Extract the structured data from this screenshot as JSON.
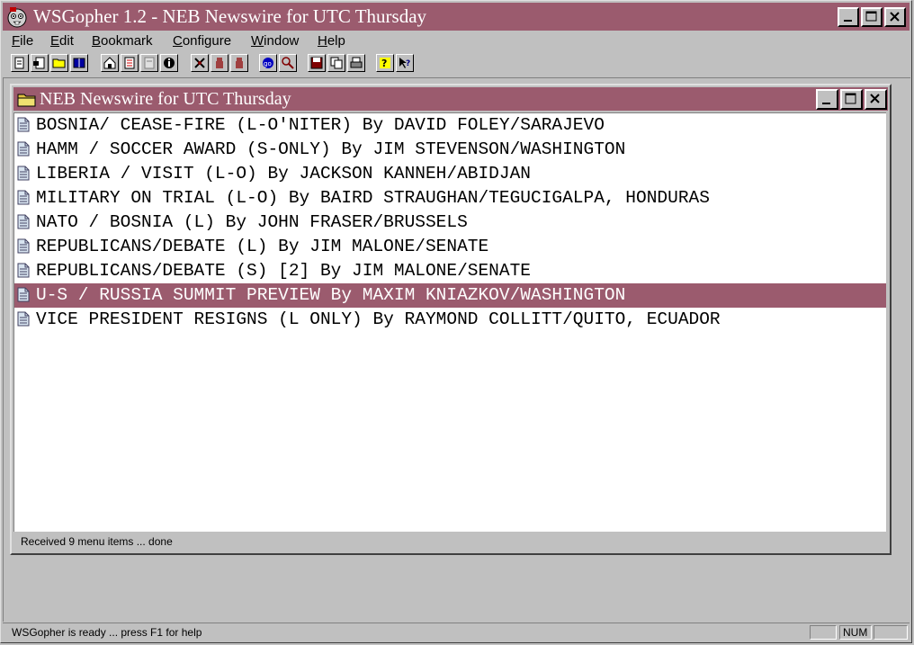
{
  "app": {
    "title": "WSGopher 1.2 - NEB Newswire for UTC Thursday",
    "title_color": "#9b5b6e"
  },
  "menu": [
    {
      "label": "File",
      "accel": "F",
      "rest": "ile"
    },
    {
      "label": "Edit",
      "accel": "E",
      "rest": "dit"
    },
    {
      "label": "Bookmark",
      "accel": "B",
      "rest": "ookmark"
    },
    {
      "label": "Configure",
      "accel": "C",
      "rest": "onfigure"
    },
    {
      "label": "Window",
      "accel": "W",
      "rest": "indow"
    },
    {
      "label": "Help",
      "accel": "H",
      "rest": "elp"
    }
  ],
  "toolbar": {
    "icons": [
      "new-doc-icon",
      "save-doc-icon",
      "open-folder-icon",
      "book-icon",
      "home-icon",
      "bookmark-list-icon",
      "bookmark-edit-icon",
      "info-icon",
      "fetch-icon",
      "stop-hand-icon",
      "cancel-hand-icon",
      "go-icon",
      "search-icon",
      "save-disk-icon",
      "copy-icon",
      "print-icon",
      "help-icon",
      "context-help-icon"
    ]
  },
  "child_window": {
    "title": "NEB Newswire for UTC Thursday",
    "items": [
      {
        "text": "BOSNIA/ CEASE-FIRE (L-O'NITER) By DAVID FOLEY/SARAJEVO",
        "selected": false
      },
      {
        "text": "HAMM / SOCCER AWARD (S-ONLY) By JIM STEVENSON/WASHINGTON",
        "selected": false
      },
      {
        "text": "LIBERIA / VISIT (L-O) By JACKSON KANNEH/ABIDJAN",
        "selected": false
      },
      {
        "text": "MILITARY ON TRIAL (L-O) By BAIRD STRAUGHAN/TEGUCIGALPA, HONDURAS",
        "selected": false
      },
      {
        "text": "NATO / BOSNIA (L) By JOHN FRASER/BRUSSELS",
        "selected": false
      },
      {
        "text": "REPUBLICANS/DEBATE (L) By JIM MALONE/SENATE",
        "selected": false
      },
      {
        "text": "REPUBLICANS/DEBATE (S) [2] By JIM MALONE/SENATE",
        "selected": false
      },
      {
        "text": "U-S / RUSSIA SUMMIT PREVIEW By MAXIM KNIAZKOV/WASHINGTON",
        "selected": true
      },
      {
        "text": "VICE PRESIDENT RESIGNS (L ONLY) By RAYMOND COLLITT/QUITO, ECUADOR",
        "selected": false
      }
    ],
    "status": "Received 9 menu items ... done"
  },
  "status_bar": {
    "text": "WSGopher is ready ... press F1 for help",
    "num": "NUM"
  }
}
